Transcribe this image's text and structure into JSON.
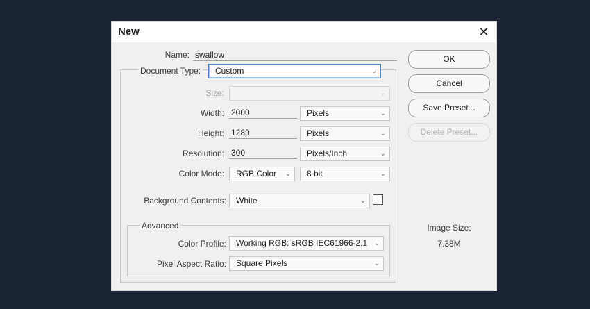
{
  "dialog": {
    "title": "New",
    "close_glyph": "✕"
  },
  "name": {
    "label": "Name:",
    "value": "swallow"
  },
  "document_type": {
    "label": "Document Type:",
    "value": "Custom"
  },
  "size": {
    "label": "Size:",
    "value": ""
  },
  "width": {
    "label": "Width:",
    "value": "2000",
    "unit": "Pixels"
  },
  "height": {
    "label": "Height:",
    "value": "1289",
    "unit": "Pixels"
  },
  "resolution": {
    "label": "Resolution:",
    "value": "300",
    "unit": "Pixels/Inch"
  },
  "color_mode": {
    "label": "Color Mode:",
    "value": "RGB Color",
    "depth": "8 bit"
  },
  "background": {
    "label": "Background Contents:",
    "value": "White"
  },
  "advanced": {
    "title": "Advanced",
    "color_profile": {
      "label": "Color Profile:",
      "value": "Working RGB:  sRGB IEC61966-2.1"
    },
    "pixel_aspect": {
      "label": "Pixel Aspect Ratio:",
      "value": "Square Pixels"
    }
  },
  "buttons": {
    "ok": "OK",
    "cancel": "Cancel",
    "save_preset": "Save Preset...",
    "delete_preset": "Delete Preset..."
  },
  "image_size": {
    "label": "Image Size:",
    "value": "7.38M"
  },
  "icons": {
    "dropdown": "chevron-down-icon",
    "close": "close-icon"
  },
  "colors": {
    "background": "#1b2435",
    "dialog": "#f0f0f0",
    "focus_border": "#4a86c8"
  }
}
